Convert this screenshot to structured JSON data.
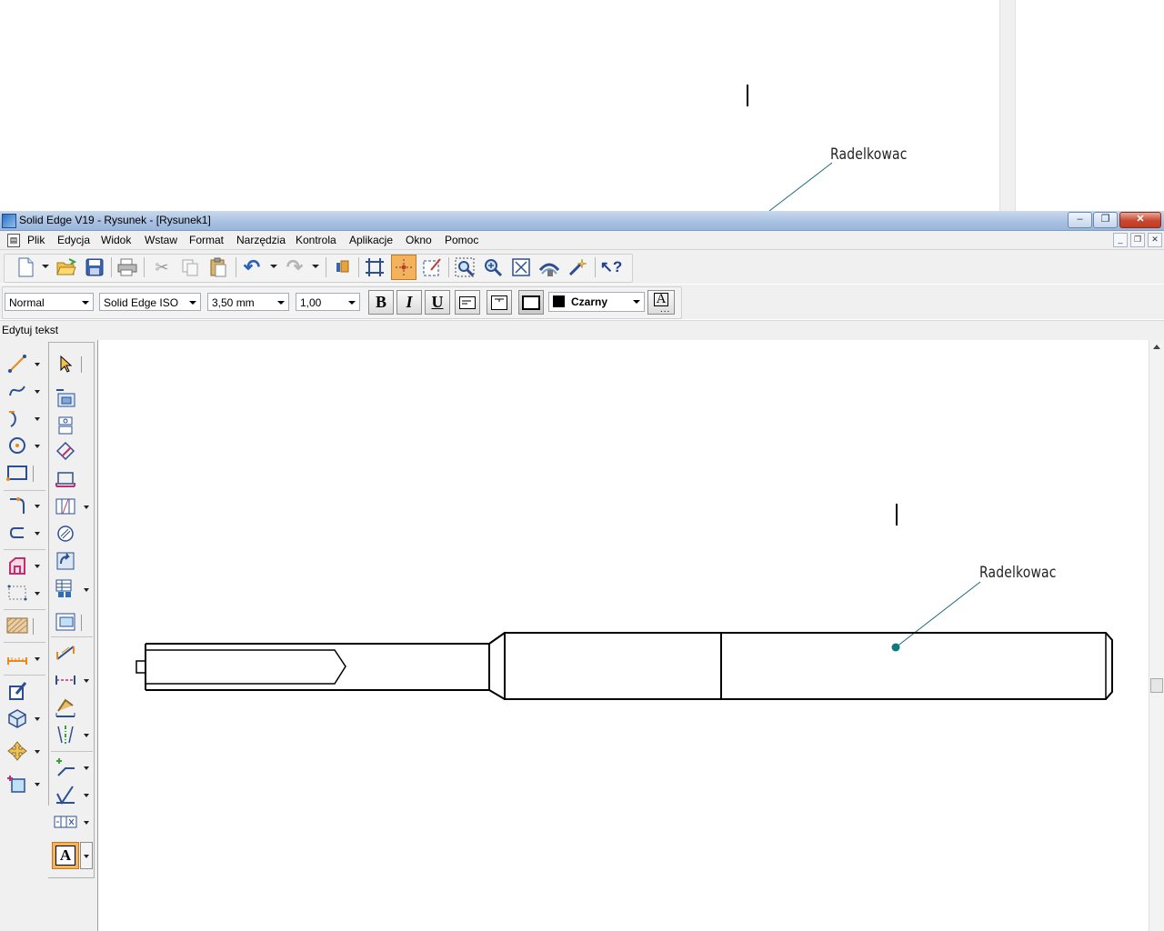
{
  "background_sheet": {
    "annotation_text": "Radelkowac"
  },
  "window": {
    "title": "Solid Edge V19 - Rysunek - [Rysunek1]",
    "controls": {
      "minimize": "–",
      "restore": "❐",
      "close": "✕"
    }
  },
  "menu": {
    "items": [
      "Plik",
      "Edycja",
      "Widok",
      "Wstaw",
      "Format",
      "Narzędzia",
      "Kontrola",
      "Aplikacje",
      "Okno",
      "Pomoc"
    ],
    "mdi_controls": {
      "minimize": "_",
      "restore": "❐",
      "close": "✕"
    }
  },
  "main_toolbar": {
    "icons": [
      "new-document-icon",
      "open-folder-icon",
      "save-icon",
      "print-icon",
      "cut-icon",
      "copy-icon",
      "paste-icon",
      "undo-icon",
      "redo-icon",
      "properties-icon",
      "grid-icon",
      "snap-icon",
      "sketch-edit-icon",
      "zoom-area-icon",
      "zoom-icon",
      "fit-icon",
      "pan-icon",
      "magic-icon",
      "help-icon"
    ]
  },
  "format_toolbar": {
    "style": "Normal",
    "font": "Solid Edge ISO",
    "size": "3,50 mm",
    "scale": "1,00",
    "bold_label": "B",
    "italic_label": "I",
    "underline_label": "U",
    "color_name": "Czarny",
    "color_swatch": "#000000",
    "text_options_label": "A"
  },
  "mode_strip": {
    "label": "Edytuj tekst"
  },
  "drawing": {
    "annotation_text": "Radelkowac",
    "line_color": "#000000",
    "leader_color": "#1a6b7a",
    "leader_dot_color": "#0e7b7b"
  },
  "theme": {
    "titlebar_accent": "#9ab6dc",
    "active_tool_highlight": "#f5b25c"
  }
}
